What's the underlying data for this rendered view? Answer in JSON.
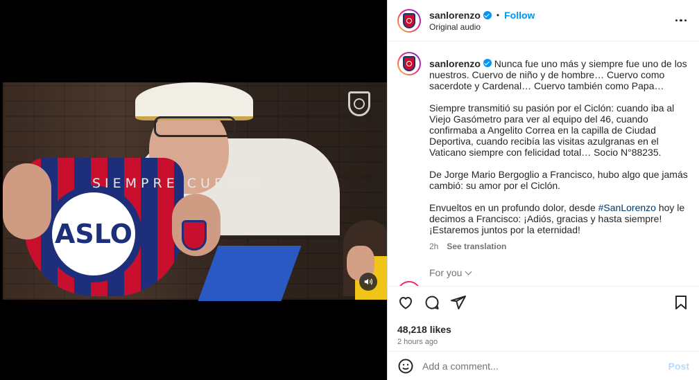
{
  "video": {
    "overlay_text": "SIEMPRE CUERVO",
    "pennant_text": "ASLO",
    "mute_icon": "speaker-icon"
  },
  "header": {
    "username": "sanlorenzo",
    "dot": "•",
    "follow_label": "Follow",
    "audio": "Original audio"
  },
  "caption": {
    "username": "sanlorenzo",
    "para1": "Nunca fue uno más y siempre fue uno de los nuestros. Cuervo de niño y de hombre… Cuervo como sacerdote y Cardenal… Cuervo también como Papa…",
    "para2": "Siempre transmitió su pasión por el Ciclón: cuando iba al Viejo Gasómetro para ver al equipo del 46, cuando confirmaba a Angelito Correa en la capilla de Ciudad Deportiva, cuando recibía las visitas azulgranas en el Vaticano siempre con felicidad total… Socio N°88235.",
    "para3": "De Jorge Mario Bergoglio a Francisco, hubo algo que jamás cambió: su amor por el Ciclón.",
    "para4_start": "Envueltos en un profundo dolor, desde ",
    "hashtag": "#SanLorenzo",
    "para4_end": " hoy le decimos a Francisco: ¡Adiós, gracias y hasta siempre! ¡Estaremos juntos por la eternidad!",
    "age": "2h",
    "see_translation": "See translation"
  },
  "for_you": "For you",
  "stats": {
    "likes": "48,218 likes",
    "time": "2 hours ago"
  },
  "comment": {
    "placeholder": "Add a comment...",
    "post_label": "Post"
  },
  "colors": {
    "accent": "#0095f6",
    "club_red": "#c8102e",
    "club_blue": "#1d2f7a"
  }
}
